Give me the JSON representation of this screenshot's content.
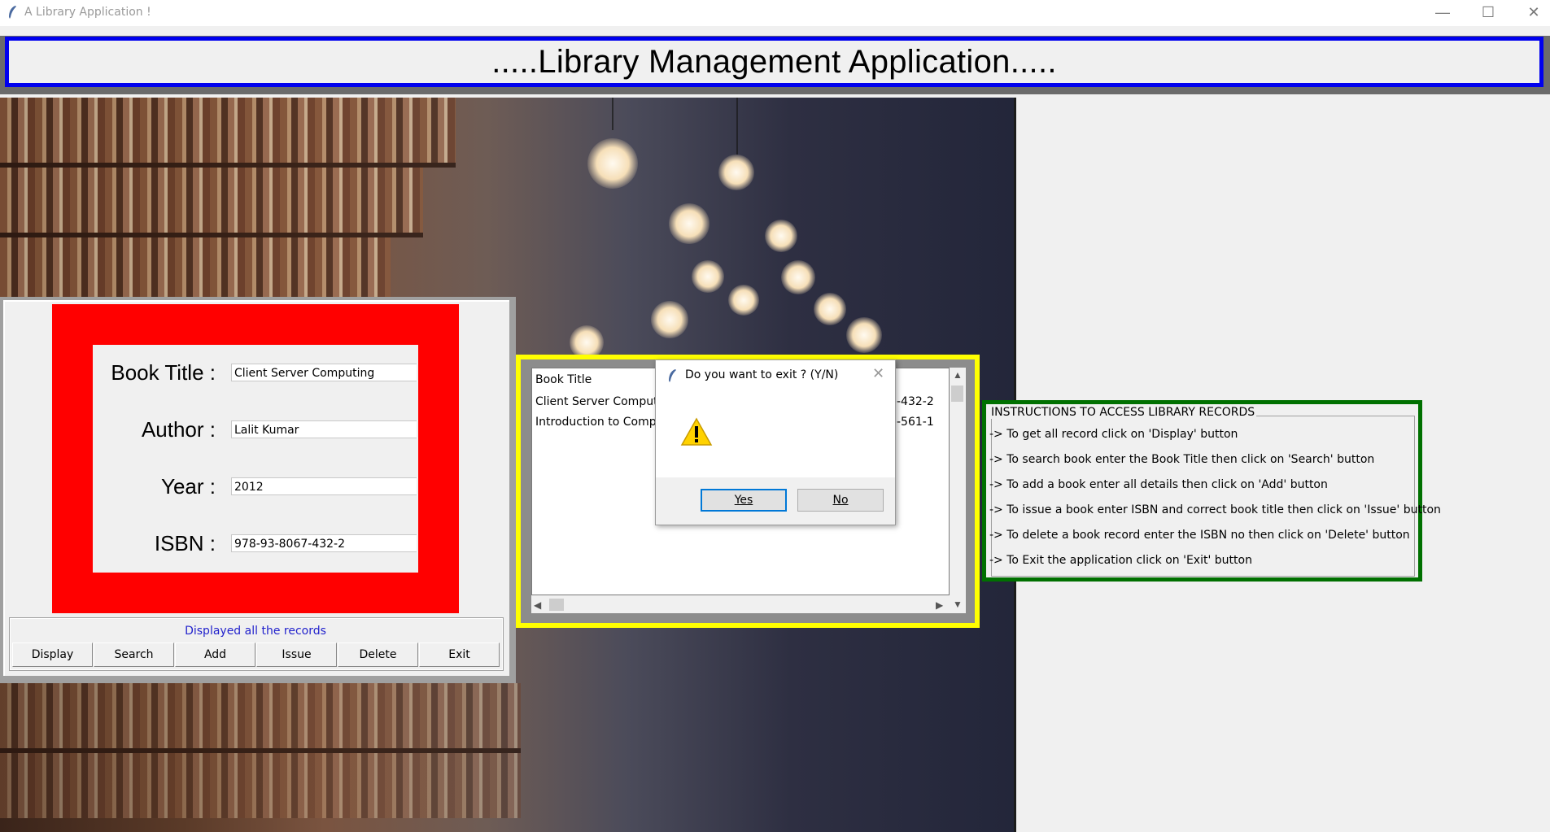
{
  "window": {
    "title": "A Library Application !",
    "minimize": "—",
    "maximize": "☐",
    "close": "✕"
  },
  "banner": {
    "title": ".....Library Management Application....."
  },
  "form": {
    "title_label": "Book Title :",
    "title_value": "Client Server Computing",
    "author_label": "Author :",
    "author_value": "Lalit Kumar",
    "year_label": "Year :",
    "year_value": "2012",
    "isbn_label": "ISBN :",
    "isbn_value": "978-93-8067-432-2"
  },
  "status": {
    "text": "Displayed all the records"
  },
  "buttons": {
    "display": "Display",
    "search": "Search",
    "add": "Add",
    "issue": "Issue",
    "delete": "Delete",
    "exit": "Exit"
  },
  "listbox": {
    "header": "Book Title",
    "rows": [
      "Client Server Comput",
      "Introduction to Comp"
    ],
    "right_fragments": [
      "-432-2",
      "-561-1"
    ]
  },
  "dialog": {
    "title": "Do you want to exit ? (Y/N)",
    "yes": "Yes",
    "no": "No",
    "close": "✕"
  },
  "instructions": {
    "title": "INSTRUCTIONS TO ACCESS LIBRARY RECORDS",
    "lines": [
      "-> To get all record click on 'Display' button",
      "-> To search book enter the Book Title then click on 'Search' button",
      "-> To add a book enter all details then click on 'Add' button",
      "-> To issue a book enter ISBN and correct book title then click on 'Issue' button",
      "-> To delete a book record enter the ISBN no then click on 'Delete' button",
      "-> To Exit the application click on 'Exit' button"
    ]
  },
  "colors": {
    "banner_border": "#0000ee",
    "form_frame": "#ff0000",
    "list_frame": "#ffff00",
    "instructions_frame": "#007000",
    "status_text": "#2222cc"
  }
}
